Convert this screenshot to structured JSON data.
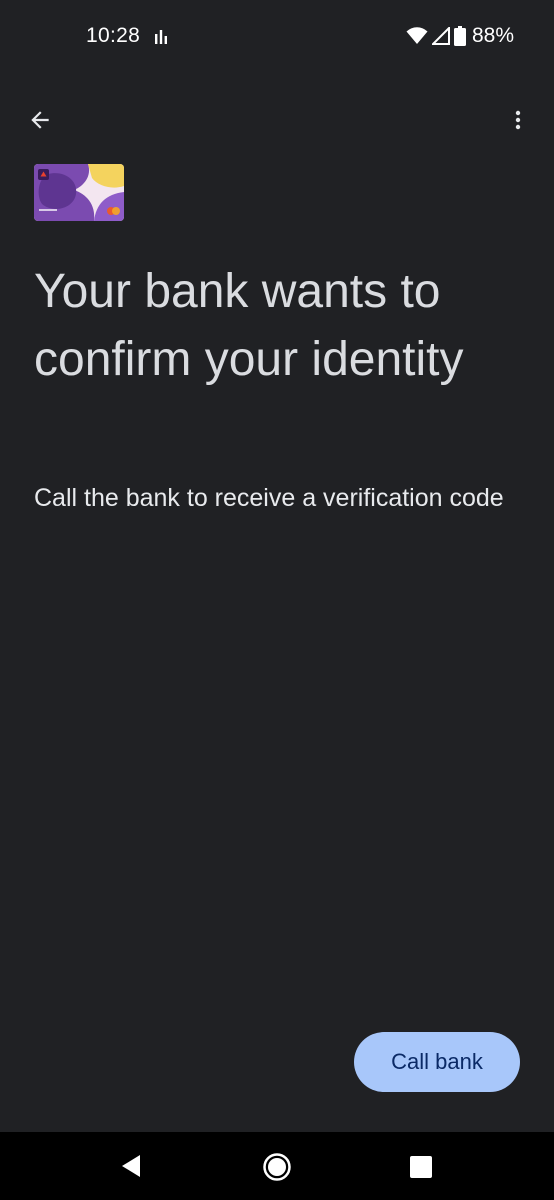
{
  "status_bar": {
    "time": "10:28",
    "battery": "88%",
    "icons": [
      "activity-bars-icon",
      "wifi-icon",
      "cell-signal-icon",
      "battery-icon"
    ]
  },
  "app_bar": {
    "back_icon": "arrow-back-icon",
    "more_icon": "more-vert-icon"
  },
  "card": {
    "brand_text": "Lmzn",
    "number_text": "•••• 4637",
    "colors": {
      "purple": "#6b3fa0",
      "yellow": "#f4d35e",
      "accent": "#ea5a2e"
    }
  },
  "main": {
    "headline": "Your bank wants to confirm your identity",
    "subtext": "Call the bank to receive a verification code"
  },
  "actions": {
    "call_button_label": "Call bank"
  },
  "theme": {
    "background": "#202124",
    "button_bg": "#a8c7fa",
    "button_text": "#0b2a66"
  },
  "nav_bar": {
    "icons": [
      "nav-back-icon",
      "nav-home-icon",
      "nav-recents-icon"
    ]
  }
}
